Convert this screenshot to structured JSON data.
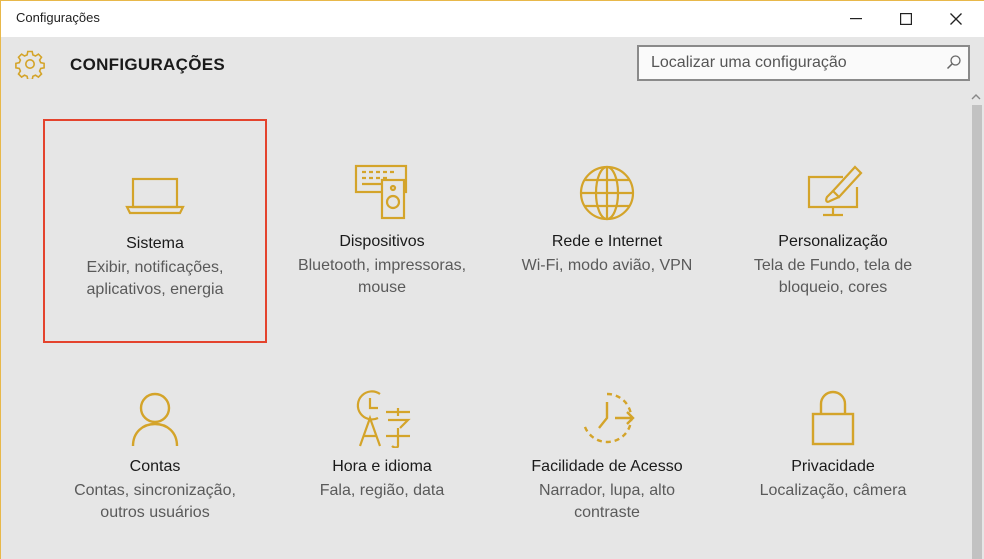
{
  "window": {
    "title": "Configurações"
  },
  "header": {
    "title": "CONFIGURAÇÕES",
    "search_placeholder": "Localizar uma configuração"
  },
  "colors": {
    "accent": "#d4a42a",
    "selection_border": "#e4432d"
  },
  "tiles": [
    {
      "name": "Sistema",
      "description": "Exibir, notificações, aplicativos, energia",
      "icon": "laptop-icon",
      "selected": true
    },
    {
      "name": "Dispositivos",
      "description": "Bluetooth, impressoras, mouse",
      "icon": "devices-icon",
      "selected": false
    },
    {
      "name": "Rede e Internet",
      "description": "Wi-Fi, modo avião, VPN",
      "icon": "globe-icon",
      "selected": false
    },
    {
      "name": "Personalização",
      "description": "Tela de Fundo, tela de bloqueio, cores",
      "icon": "paint-icon",
      "selected": false
    },
    {
      "name": "Contas",
      "description": "Contas, sincronização, outros usuários",
      "icon": "person-icon",
      "selected": false
    },
    {
      "name": "Hora e idioma",
      "description": "Fala, região, data",
      "icon": "time-language-icon",
      "selected": false
    },
    {
      "name": "Facilidade de Acesso",
      "description": "Narrador, lupa, alto contraste",
      "icon": "ease-of-access-icon",
      "selected": false
    },
    {
      "name": "Privacidade",
      "description": "Localização, câmera",
      "icon": "lock-icon",
      "selected": false
    }
  ]
}
